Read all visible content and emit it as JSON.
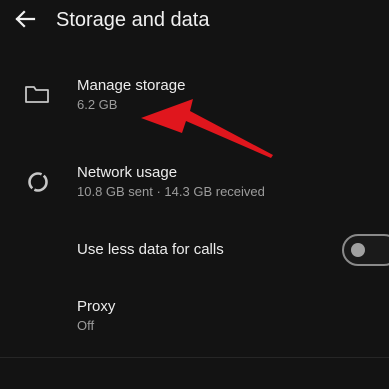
{
  "header": {
    "title": "Storage and data"
  },
  "settings": {
    "manage_storage": {
      "label": "Manage storage",
      "value": "6.2 GB"
    },
    "network_usage": {
      "label": "Network usage",
      "value": "10.8 GB sent · 14.3 GB received"
    },
    "use_less_data": {
      "label": "Use less data for calls",
      "enabled": false
    },
    "proxy": {
      "label": "Proxy",
      "value": "Off"
    }
  },
  "icons": {
    "back": "arrow-left-icon",
    "storage": "folder-icon",
    "network": "network-usage-icon"
  },
  "colors": {
    "background": "#131313",
    "text_primary": "#ececec",
    "text_secondary": "#9c9c9c",
    "annotation": "#e0161d"
  }
}
